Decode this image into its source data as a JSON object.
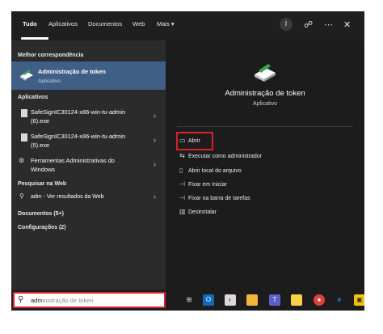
{
  "tabs": [
    {
      "label": "Tudo"
    },
    {
      "label": "Aplicativos"
    },
    {
      "label": "Documentos"
    },
    {
      "label": "Web"
    },
    {
      "label": "Mais ▾"
    }
  ],
  "account_initial": "I",
  "sections": {
    "best_match": "Melhor correspondência",
    "apps": "Aplicativos",
    "web": "Pesquisar na Web",
    "documents": "Documentos (5+)",
    "settings": "Configurações (2)"
  },
  "best_match": {
    "title": "Administração de token",
    "subtitle": "Aplicativo"
  },
  "apps": [
    {
      "line1": "SafeSignIC30124-x86-win-tu-admin",
      "line2": "(6).exe"
    },
    {
      "line1": "SafeSignIC30124-x86-win-tu-admin",
      "line2": "(5).exe"
    },
    {
      "line1": "Ferramentas Administrativas do",
      "line2": "Windows"
    }
  ],
  "web_result": "adm - Ver resultados da Web",
  "detail": {
    "title": "Administração de token",
    "subtitle": "Aplicativo",
    "actions": [
      {
        "label": "Abrir",
        "icon": "open-icon"
      },
      {
        "label": "Executar como administrador",
        "icon": "run-as-admin-icon"
      },
      {
        "label": "Abrir local do arquivo",
        "icon": "folder-icon"
      },
      {
        "label": "Fixar em Iniciar",
        "icon": "pin-icon"
      },
      {
        "label": "Fixar na barra de tarefas",
        "icon": "pin-icon"
      },
      {
        "label": "Desinstalar",
        "icon": "trash-icon"
      }
    ]
  },
  "search": {
    "typed": "adm",
    "suggestion": "inistração de token"
  },
  "taskbar_icons": [
    "task-view-icon",
    "outlook-icon",
    "photos-icon",
    "file-explorer-icon",
    "teams-icon",
    "sticky-notes-icon",
    "chrome-icon",
    "edge-icon",
    "security-icon"
  ],
  "colors": {
    "accent": "#3f5f87",
    "highlight": "#d7232c"
  }
}
